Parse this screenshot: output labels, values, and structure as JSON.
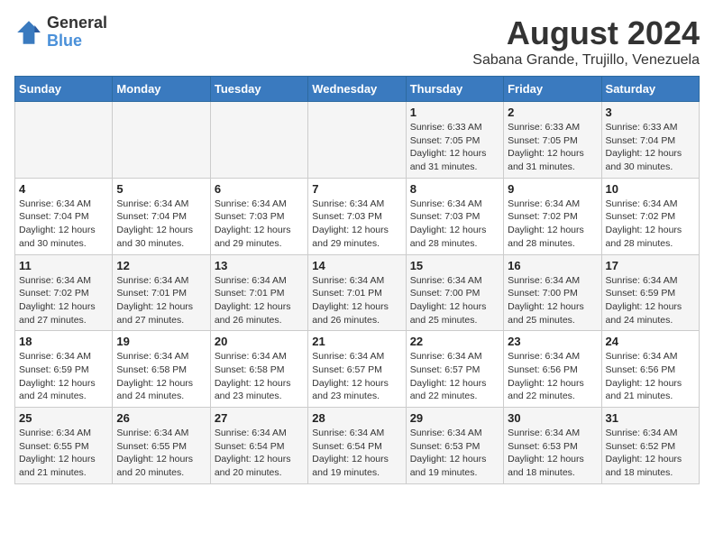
{
  "logo": {
    "text_general": "General",
    "text_blue": "Blue"
  },
  "title": "August 2024",
  "subtitle": "Sabana Grande, Trujillo, Venezuela",
  "days_of_week": [
    "Sunday",
    "Monday",
    "Tuesday",
    "Wednesday",
    "Thursday",
    "Friday",
    "Saturday"
  ],
  "weeks": [
    [
      {
        "day": "",
        "detail": ""
      },
      {
        "day": "",
        "detail": ""
      },
      {
        "day": "",
        "detail": ""
      },
      {
        "day": "",
        "detail": ""
      },
      {
        "day": "1",
        "detail": "Sunrise: 6:33 AM\nSunset: 7:05 PM\nDaylight: 12 hours and 31 minutes."
      },
      {
        "day": "2",
        "detail": "Sunrise: 6:33 AM\nSunset: 7:05 PM\nDaylight: 12 hours and 31 minutes."
      },
      {
        "day": "3",
        "detail": "Sunrise: 6:33 AM\nSunset: 7:04 PM\nDaylight: 12 hours and 30 minutes."
      }
    ],
    [
      {
        "day": "4",
        "detail": "Sunrise: 6:34 AM\nSunset: 7:04 PM\nDaylight: 12 hours and 30 minutes."
      },
      {
        "day": "5",
        "detail": "Sunrise: 6:34 AM\nSunset: 7:04 PM\nDaylight: 12 hours and 30 minutes."
      },
      {
        "day": "6",
        "detail": "Sunrise: 6:34 AM\nSunset: 7:03 PM\nDaylight: 12 hours and 29 minutes."
      },
      {
        "day": "7",
        "detail": "Sunrise: 6:34 AM\nSunset: 7:03 PM\nDaylight: 12 hours and 29 minutes."
      },
      {
        "day": "8",
        "detail": "Sunrise: 6:34 AM\nSunset: 7:03 PM\nDaylight: 12 hours and 28 minutes."
      },
      {
        "day": "9",
        "detail": "Sunrise: 6:34 AM\nSunset: 7:02 PM\nDaylight: 12 hours and 28 minutes."
      },
      {
        "day": "10",
        "detail": "Sunrise: 6:34 AM\nSunset: 7:02 PM\nDaylight: 12 hours and 28 minutes."
      }
    ],
    [
      {
        "day": "11",
        "detail": "Sunrise: 6:34 AM\nSunset: 7:02 PM\nDaylight: 12 hours and 27 minutes."
      },
      {
        "day": "12",
        "detail": "Sunrise: 6:34 AM\nSunset: 7:01 PM\nDaylight: 12 hours and 27 minutes."
      },
      {
        "day": "13",
        "detail": "Sunrise: 6:34 AM\nSunset: 7:01 PM\nDaylight: 12 hours and 26 minutes."
      },
      {
        "day": "14",
        "detail": "Sunrise: 6:34 AM\nSunset: 7:01 PM\nDaylight: 12 hours and 26 minutes."
      },
      {
        "day": "15",
        "detail": "Sunrise: 6:34 AM\nSunset: 7:00 PM\nDaylight: 12 hours and 25 minutes."
      },
      {
        "day": "16",
        "detail": "Sunrise: 6:34 AM\nSunset: 7:00 PM\nDaylight: 12 hours and 25 minutes."
      },
      {
        "day": "17",
        "detail": "Sunrise: 6:34 AM\nSunset: 6:59 PM\nDaylight: 12 hours and 24 minutes."
      }
    ],
    [
      {
        "day": "18",
        "detail": "Sunrise: 6:34 AM\nSunset: 6:59 PM\nDaylight: 12 hours and 24 minutes."
      },
      {
        "day": "19",
        "detail": "Sunrise: 6:34 AM\nSunset: 6:58 PM\nDaylight: 12 hours and 24 minutes."
      },
      {
        "day": "20",
        "detail": "Sunrise: 6:34 AM\nSunset: 6:58 PM\nDaylight: 12 hours and 23 minutes."
      },
      {
        "day": "21",
        "detail": "Sunrise: 6:34 AM\nSunset: 6:57 PM\nDaylight: 12 hours and 23 minutes."
      },
      {
        "day": "22",
        "detail": "Sunrise: 6:34 AM\nSunset: 6:57 PM\nDaylight: 12 hours and 22 minutes."
      },
      {
        "day": "23",
        "detail": "Sunrise: 6:34 AM\nSunset: 6:56 PM\nDaylight: 12 hours and 22 minutes."
      },
      {
        "day": "24",
        "detail": "Sunrise: 6:34 AM\nSunset: 6:56 PM\nDaylight: 12 hours and 21 minutes."
      }
    ],
    [
      {
        "day": "25",
        "detail": "Sunrise: 6:34 AM\nSunset: 6:55 PM\nDaylight: 12 hours and 21 minutes."
      },
      {
        "day": "26",
        "detail": "Sunrise: 6:34 AM\nSunset: 6:55 PM\nDaylight: 12 hours and 20 minutes."
      },
      {
        "day": "27",
        "detail": "Sunrise: 6:34 AM\nSunset: 6:54 PM\nDaylight: 12 hours and 20 minutes."
      },
      {
        "day": "28",
        "detail": "Sunrise: 6:34 AM\nSunset: 6:54 PM\nDaylight: 12 hours and 19 minutes."
      },
      {
        "day": "29",
        "detail": "Sunrise: 6:34 AM\nSunset: 6:53 PM\nDaylight: 12 hours and 19 minutes."
      },
      {
        "day": "30",
        "detail": "Sunrise: 6:34 AM\nSunset: 6:53 PM\nDaylight: 12 hours and 18 minutes."
      },
      {
        "day": "31",
        "detail": "Sunrise: 6:34 AM\nSunset: 6:52 PM\nDaylight: 12 hours and 18 minutes."
      }
    ]
  ]
}
